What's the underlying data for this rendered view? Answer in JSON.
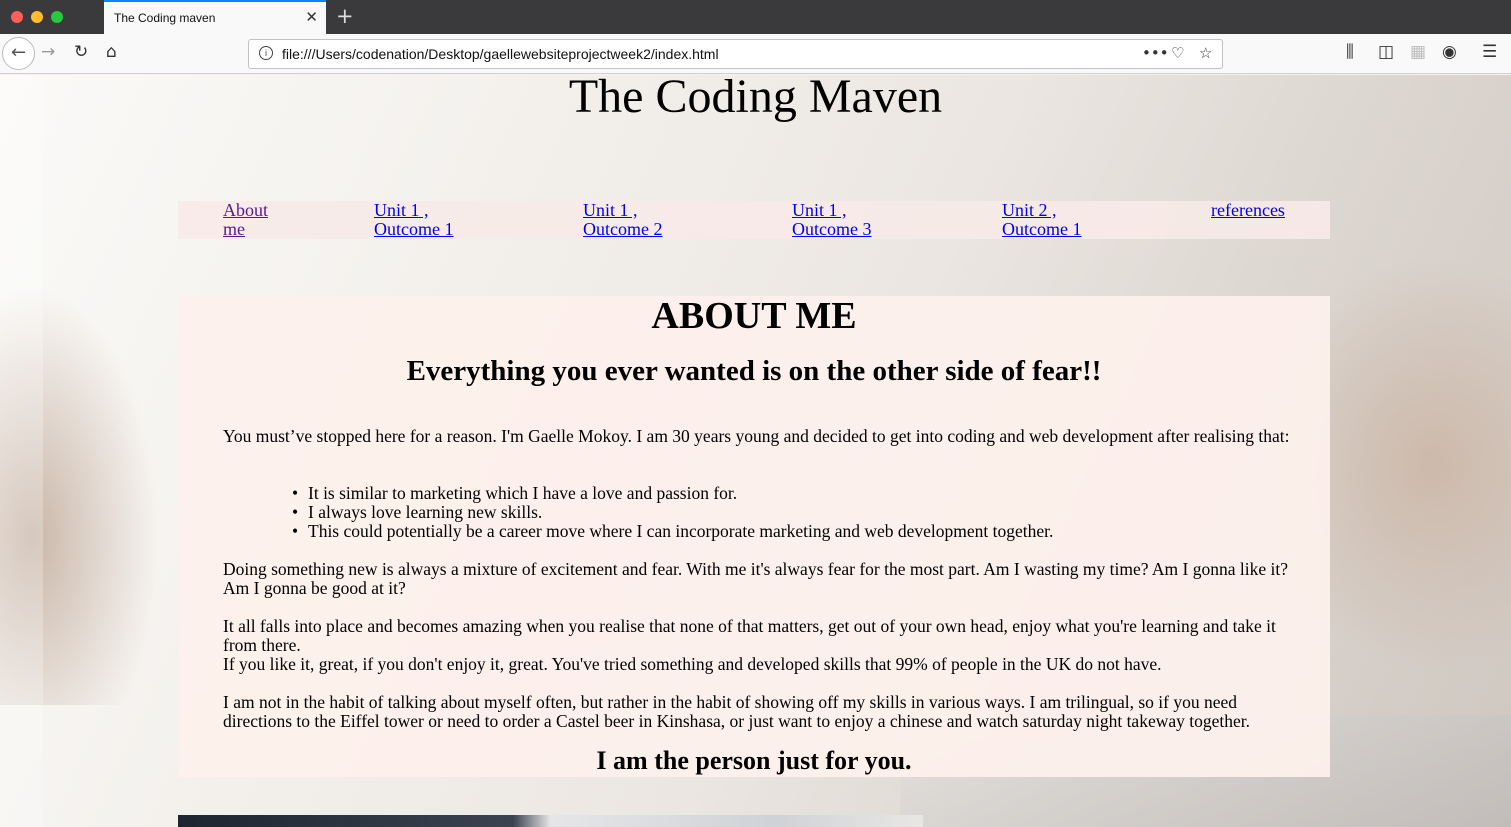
{
  "browser": {
    "tab_title": "The Coding maven",
    "url": "file:///Users/codenation/Desktop/gaellewebsiteprojectweek2/index.html"
  },
  "page": {
    "title": "The Coding Maven",
    "nav": [
      {
        "line1": "About",
        "line2": "me"
      },
      {
        "line1": "Unit 1 ,",
        "line2": "Outcome 1"
      },
      {
        "line1": "Unit 1 ,",
        "line2": "Outcome 2"
      },
      {
        "line1": "Unit 1 ,",
        "line2": "Outcome 3"
      },
      {
        "line1": "Unit 2 ,",
        "line2": "Outcome 1"
      },
      {
        "line1": "references",
        "line2": ""
      }
    ],
    "about": {
      "heading": "ABOUT ME",
      "subheading": "Everything you ever wanted is on the other side of fear!!",
      "intro": "You must’ve stopped here for a reason. I'm Gaelle Mokoy. I am 30 years young and decided to get into coding and web development after realising that:",
      "bullets": [
        "It is similar to marketing which I have a love and passion for.",
        "I always love learning new skills.",
        "This could potentially be a career move where I can incorporate marketing and web development together."
      ],
      "p2": "Doing something new is always a mixture of excitement and fear. With me it's always fear for the most part. Am I wasting my time? Am I gonna like it? Am I gonna be good at it?",
      "p3": "It all falls into place and becomes amazing when you realise that none of that matters, get out of your own head, enjoy what you're learning and take it from there.",
      "p4": "If you like it, great, if you don't enjoy it, great. You've tried something and developed skills that 99% of people in the UK do not have.",
      "p5": "I am not in the habit of talking about myself often, but rather in the habit of showing off my skills in various ways. I am trilingual, so if you need directions to the Eiffel tower or need to order a Castel beer in Kinshasa, or just want to enjoy a chinese and watch saturday night takeway together.",
      "closing": "I am the person just for you."
    }
  }
}
